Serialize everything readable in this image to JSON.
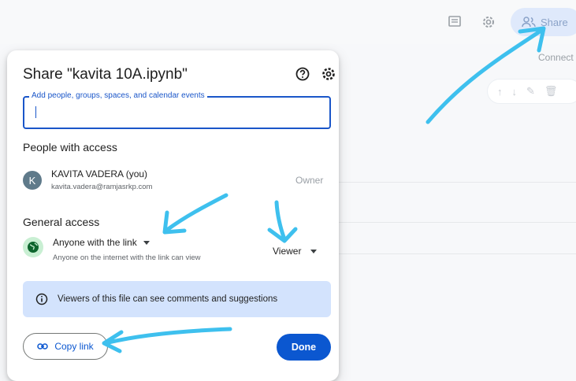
{
  "toolbar": {
    "comment_icon": "comment-icon",
    "settings_icon": "gear-icon",
    "share_label": "Share",
    "connect_label": "Connect"
  },
  "dialog": {
    "title": "Share \"kavita 10A.ipynb\"",
    "add_people_placeholder": "Add people, groups, spaces, and calendar events",
    "people_heading": "People with access",
    "user": {
      "initial": "K",
      "name": "KAVITA VADERA (you)",
      "email": "kavita.vadera@ramjasrkp.com",
      "role": "Owner"
    },
    "general_heading": "General access",
    "access_option": "Anyone with the link",
    "access_description": "Anyone on the internet with the link can view",
    "role_option": "Viewer",
    "info_banner": "Viewers of this file can see comments and suggestions",
    "copy_link_label": "Copy link",
    "done_label": "Done"
  },
  "colors": {
    "primary": "#0b57d0",
    "banner_bg": "#d3e3fd",
    "annotation_arrow": "#3ec0ee",
    "globe_bg": "#c9efd3"
  }
}
